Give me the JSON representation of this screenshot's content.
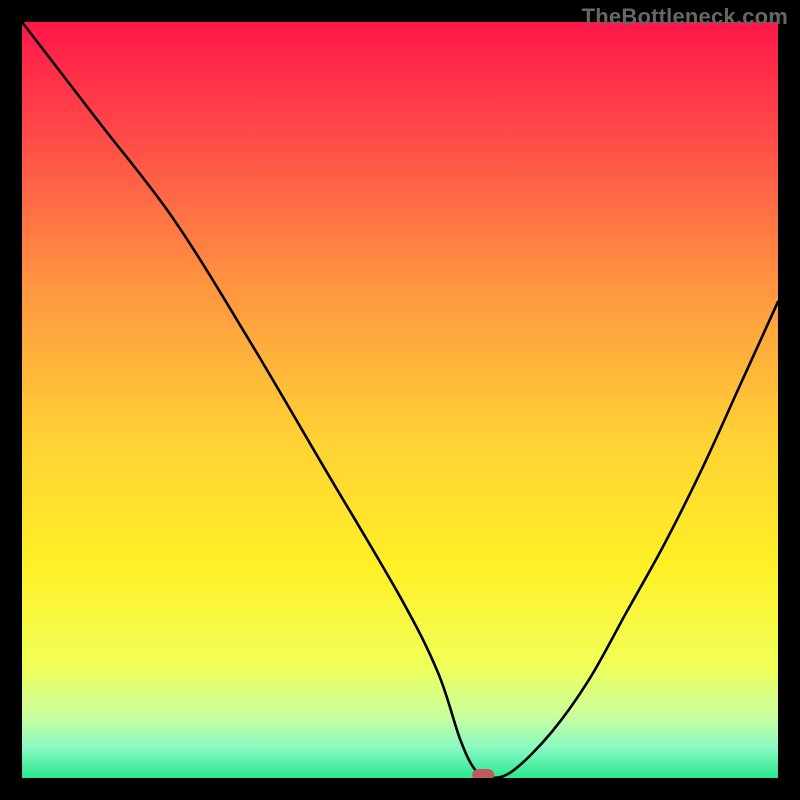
{
  "watermark": "TheBottleneck.com",
  "chart_data": {
    "type": "line",
    "title": "",
    "xlabel": "",
    "ylabel": "",
    "xlim": [
      0,
      100
    ],
    "ylim": [
      0,
      100
    ],
    "grid": false,
    "series": [
      {
        "name": "bottleneck-curve",
        "x": [
          0,
          10,
          20,
          30,
          40,
          50,
          55,
          58,
          60,
          62,
          65,
          70,
          75,
          80,
          85,
          90,
          95,
          100
        ],
        "y": [
          100,
          87,
          74,
          58,
          41,
          24,
          14,
          5,
          1,
          0,
          1,
          6,
          13,
          22,
          31,
          41,
          52,
          63
        ]
      }
    ],
    "marker": {
      "name": "optimal-point",
      "x": 61,
      "y": 0,
      "color": "#c15a5a",
      "shape": "rounded-rect"
    },
    "background": {
      "type": "vertical-gradient",
      "stops": [
        {
          "offset": 0.0,
          "color": "#ff1749"
        },
        {
          "offset": 0.15,
          "color": "#ff4a48"
        },
        {
          "offset": 0.35,
          "color": "#ff9540"
        },
        {
          "offset": 0.55,
          "color": "#ffd135"
        },
        {
          "offset": 0.72,
          "color": "#fff027"
        },
        {
          "offset": 0.85,
          "color": "#f1ff58"
        },
        {
          "offset": 0.92,
          "color": "#c8ffa0"
        },
        {
          "offset": 0.96,
          "color": "#88f9c2"
        },
        {
          "offset": 1.0,
          "color": "#27e98f"
        }
      ]
    }
  }
}
